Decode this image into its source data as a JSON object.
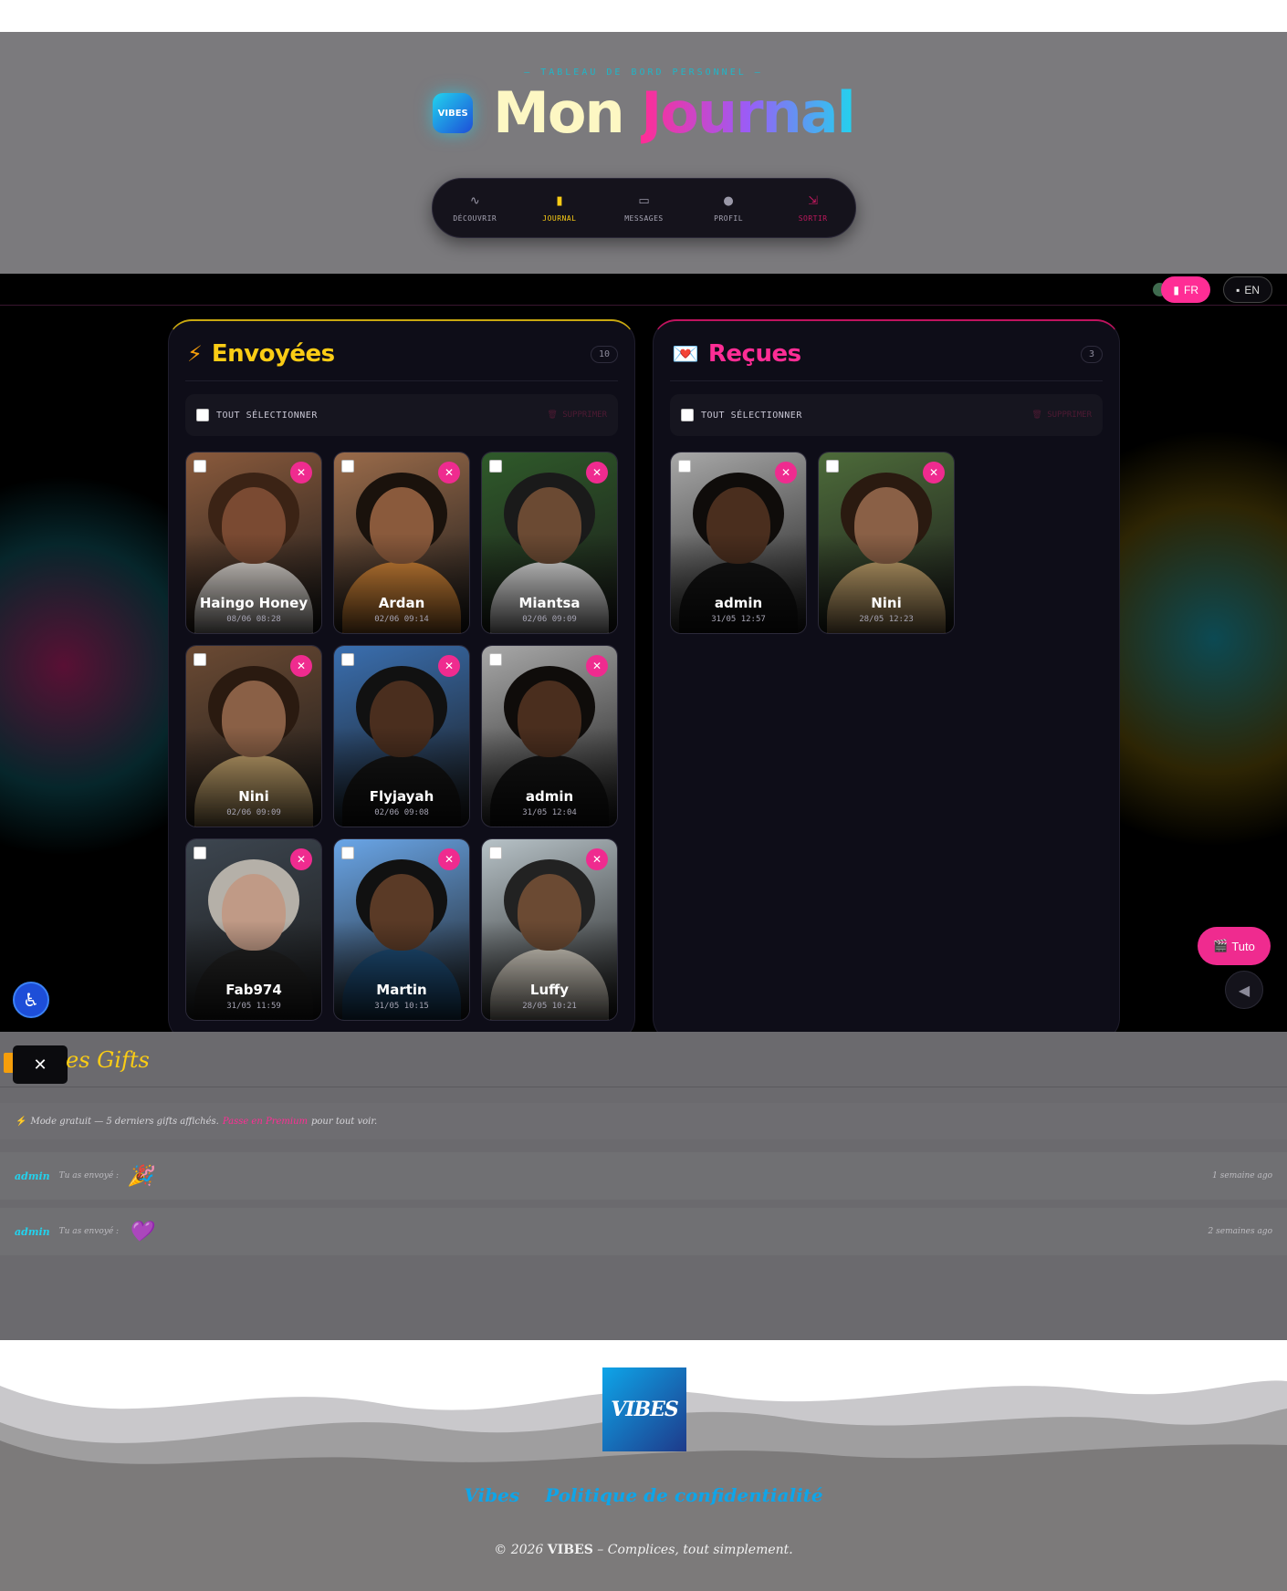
{
  "header": {
    "eyebrow": "— TABLEAU DE BORD PERSONNEL —",
    "logo_text": "VIBES",
    "title_part1": "Mon",
    "title_part2": "Journal",
    "nav": [
      {
        "label": "DÉCOUVRIR",
        "icon": "activity-icon",
        "glyph": "∿"
      },
      {
        "label": "JOURNAL",
        "icon": "notebook-icon",
        "glyph": "▮"
      },
      {
        "label": "MESSAGES",
        "icon": "chat-icon",
        "glyph": "▭"
      },
      {
        "label": "PROFIL",
        "icon": "user-icon",
        "glyph": "●"
      },
      {
        "label": "SORTIR",
        "icon": "logout-icon",
        "glyph": "⇲"
      }
    ]
  },
  "lang": {
    "fr": "FR",
    "en": "EN"
  },
  "sent": {
    "title": "Envoyées",
    "count": "10",
    "select_all": "TOUT SÉLECTIONNER",
    "delete": "SUPPRIMER",
    "cards": [
      {
        "name": "Haingo Honey",
        "date": "08/06 08:28",
        "bg": "#8a5a3c",
        "skin": "#7a4a32",
        "hair": "#3b2315",
        "shirt": "#e8e2dc"
      },
      {
        "name": "Ardan",
        "date": "02/06 09:14",
        "bg": "#9a6b4a",
        "skin": "#8a5a3c",
        "hair": "#1a120c",
        "shirt": "#d98a3a"
      },
      {
        "name": "Miantsa",
        "date": "02/06 09:09",
        "bg": "#2f5a2a",
        "skin": "#6b4a33",
        "hair": "#1a1a1a",
        "shirt": "#e5e5e5"
      },
      {
        "name": "Nini",
        "date": "02/06 09:09",
        "bg": "#6b4a33",
        "skin": "#8a6046",
        "hair": "#2a1a10",
        "shirt": "#c9a870"
      },
      {
        "name": "Flyjayah",
        "date": "02/06 09:08",
        "bg": "#3a6fb0",
        "skin": "#4a2e1e",
        "hair": "#111",
        "shirt": "#151515"
      },
      {
        "name": "admin",
        "date": "31/05 12:04",
        "bg": "#a8a8a8",
        "skin": "#4a2e1e",
        "hair": "#0f0c0a",
        "shirt": "#141414"
      },
      {
        "name": "Fab974",
        "date": "31/05 11:59",
        "bg": "#3d4650",
        "skin": "#c09a86",
        "hair": "#b5b0a8",
        "shirt": "#222"
      },
      {
        "name": "Martin",
        "date": "31/05 10:15",
        "bg": "#6aa6e8",
        "skin": "#5a3a26",
        "hair": "#111",
        "shirt": "#1f4f7a"
      },
      {
        "name": "Luffy",
        "date": "28/05 10:21",
        "bg": "#b7c2c7",
        "skin": "#6b4a33",
        "hair": "#222",
        "shirt": "#d8d2c6"
      }
    ]
  },
  "received": {
    "title": "Reçues",
    "count": "3",
    "select_all": "TOUT SÉLECTIONNER",
    "delete": "SUPPRIMER",
    "cards": [
      {
        "name": "admin",
        "date": "31/05 12:57",
        "bg": "#a8a8a8",
        "skin": "#4a2e1e",
        "hair": "#0f0c0a",
        "shirt": "#141414"
      },
      {
        "name": "Nini",
        "date": "28/05 12:23",
        "bg": "#4d6b3a",
        "skin": "#8a6046",
        "hair": "#2a1a10",
        "shirt": "#c9a870"
      }
    ]
  },
  "tuto_label": "Tuto",
  "gifts": {
    "title": "es Gifts",
    "notice_prefix": "Mode gratuit — 5 derniers gifts affichés.",
    "notice_link": "Passe en Premium",
    "notice_suffix": "pour tout voir.",
    "rows": [
      {
        "from": "admin",
        "action": "Tu as envoyé :",
        "gift": "🎉",
        "ago": "1 semaine ago"
      },
      {
        "from": "admin",
        "action": "Tu as envoyé :",
        "gift": "💜",
        "ago": "2 semaines ago"
      }
    ]
  },
  "footer": {
    "logo_text": "VIBES",
    "links": [
      "Vibes",
      "Politique de confidentialité"
    ],
    "copyright_pre": "© 2026",
    "copyright_brand": "VIBES",
    "copyright_post": "– Complices, tout simplement."
  },
  "colors": {
    "accent_pink": "#ff2d95",
    "accent_yellow": "#facc15",
    "accent_cyan": "#22d3ee"
  }
}
